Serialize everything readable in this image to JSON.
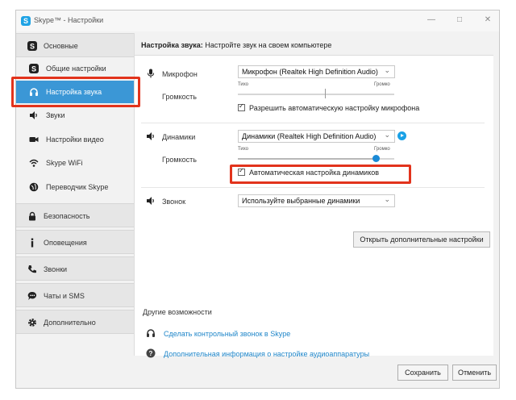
{
  "window": {
    "title": "Skype™ - Настройки",
    "logo": "S"
  },
  "titlebar_buttons": {
    "minimize": "—",
    "maximize": "□",
    "close": "✕"
  },
  "sidebar": {
    "sections": [
      {
        "label": "Основные",
        "icon": "skype-icon"
      },
      {
        "label": "Безопасность",
        "icon": "lock-icon"
      },
      {
        "label": "Оповещения",
        "icon": "info-icon"
      },
      {
        "label": "Звонки",
        "icon": "phone-icon"
      },
      {
        "label": "Чаты и SMS",
        "icon": "chat-icon"
      },
      {
        "label": "Дополнительно",
        "icon": "gear-icon"
      }
    ],
    "items": [
      {
        "label": "Общие настройки",
        "icon": "skype-icon"
      },
      {
        "label": "Настройка звука",
        "icon": "headset-icon",
        "active": true
      },
      {
        "label": "Звуки",
        "icon": "speaker-icon"
      },
      {
        "label": "Настройки видео",
        "icon": "camera-icon"
      },
      {
        "label": "Skype WiFi",
        "icon": "wifi-icon"
      },
      {
        "label": "Переводчик Skype",
        "icon": "globe-icon"
      }
    ]
  },
  "header": {
    "bold": "Настройка звука:",
    "text": " Настройте звук на своем компьютере"
  },
  "microphone": {
    "label": "Микрофон",
    "device": "Микрофон (Realtek High Definition Audio)",
    "volume_label": "Громкость",
    "min_label": "Тихо",
    "max_label": "Громко",
    "level": 0.5,
    "auto_label": "Разрешить автоматическую настройку микрофона",
    "auto_checked": "✓"
  },
  "speakers": {
    "label": "Динамики",
    "device": "Динамики (Realtek High Definition Audio)",
    "volume_label": "Громкость",
    "min_label": "Тихо",
    "max_label": "Громко",
    "level": 0.88,
    "auto_label": "Автоматическая настройка динамиков",
    "auto_checked": "✓"
  },
  "ringer": {
    "label": "Звонок",
    "device": "Используйте выбранные динамики"
  },
  "advanced_button": "Открыть дополнительные настройки",
  "other": {
    "title": "Другие возможности",
    "links": [
      {
        "label": "Сделать контрольный звонок в Skype",
        "icon": "headset-icon"
      },
      {
        "label": "Дополнительная информация о настройке аудиоаппаратуры",
        "icon": "help-icon"
      }
    ]
  },
  "footer": {
    "save": "Сохранить",
    "cancel": "Отменить"
  },
  "colors": {
    "accent": "#3b97d6",
    "highlight": "#e2331c",
    "link": "#1f86c9"
  }
}
